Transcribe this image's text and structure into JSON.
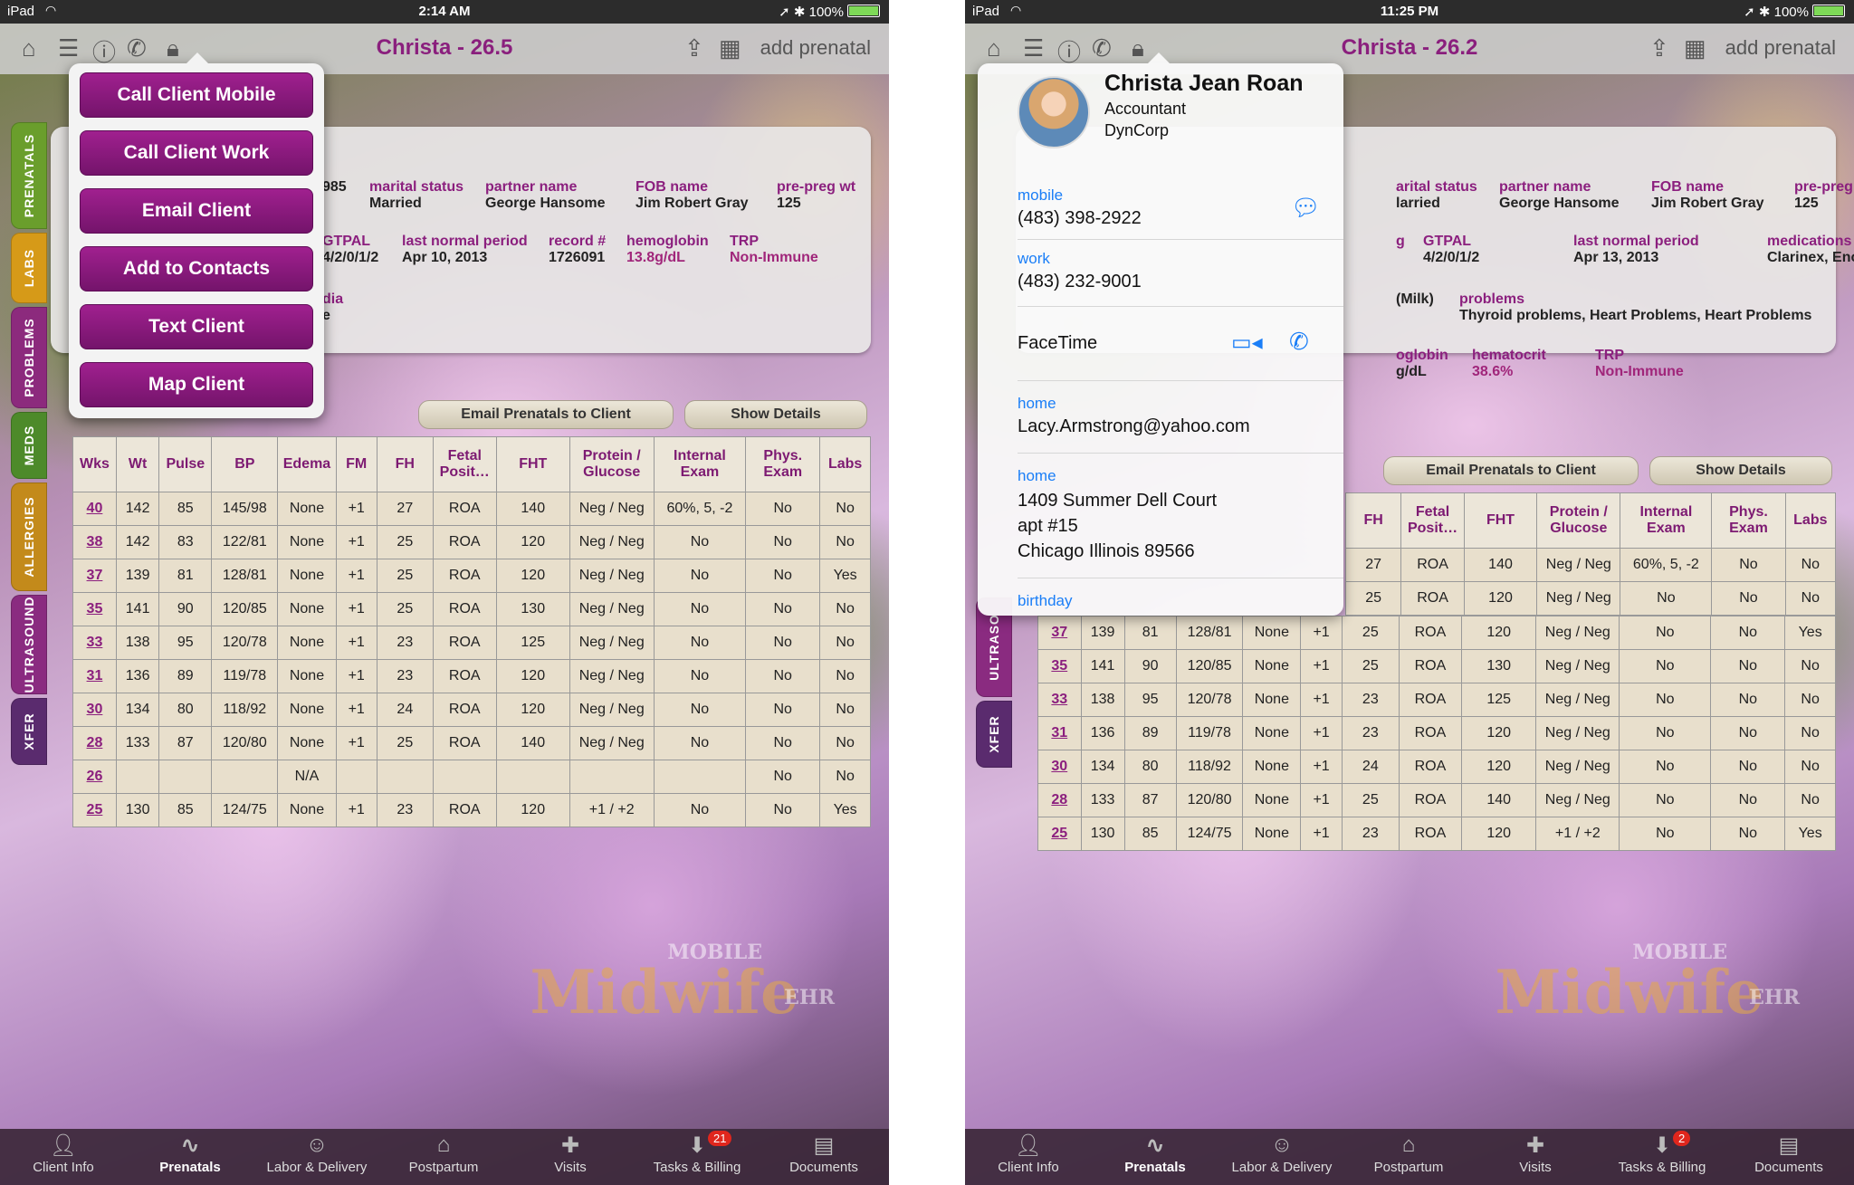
{
  "left": {
    "status": {
      "carrier": "iPad",
      "time": "2:14 AM",
      "battery": "100%"
    },
    "nav": {
      "title": "Christa - 26.5",
      "add_label": "add prenatal"
    },
    "side_tabs": [
      {
        "label": "PRENATALS",
        "color": "#6a9e2c"
      },
      {
        "label": "LABS",
        "color": "#d69a18"
      },
      {
        "label": "PROBLEMS",
        "color": "#8c2a7d"
      },
      {
        "label": "MEDS",
        "color": "#4d8a2a"
      },
      {
        "label": "ALLERGIES",
        "color": "#c38a1b"
      },
      {
        "label": "ULTRASOUND",
        "color": "#8a2b80"
      },
      {
        "label": "XFER",
        "color": "#5a2b6e"
      }
    ],
    "summary": {
      "row1": [
        {
          "label": "",
          "value": "985"
        },
        {
          "label": "marital status",
          "value": "Married"
        },
        {
          "label": "partner name",
          "value": "George Hansome"
        },
        {
          "label": "FOB name",
          "value": "Jim Robert Gray"
        },
        {
          "label": "pre-preg wt",
          "value": "125"
        }
      ],
      "row2": [
        {
          "label": "GTPAL",
          "value": "4/2/0/1/2"
        },
        {
          "label": "last normal period",
          "value": "Apr 10, 2013"
        },
        {
          "label": "record #",
          "value": "1726091"
        },
        {
          "label": "hemoglobin",
          "value": "13.8g/dL"
        },
        {
          "label": "TRP",
          "value": "Non-Immune"
        }
      ],
      "row3": [
        {
          "label": "dia",
          "value": "e"
        }
      ]
    },
    "buttons": {
      "email": "Email Prenatals to Client",
      "details": "Show Details"
    },
    "menu": [
      "Call Client Mobile",
      "Call Client Work",
      "Email Client",
      "Add to Contacts",
      "Text Client",
      "Map Client"
    ],
    "table": {
      "headers": [
        "Wks",
        "Wt",
        "Pulse",
        "BP",
        "Edema",
        "FM",
        "FH",
        "Fetal Posit…",
        "FHT",
        "Protein / Glucose",
        "Internal Exam",
        "Phys. Exam",
        "Labs"
      ],
      "rows": [
        [
          "40",
          "142",
          "85",
          "145/98",
          "None",
          "+1",
          "27",
          "ROA",
          "140",
          "Neg / Neg",
          "60%, 5, -2",
          "No",
          "No"
        ],
        [
          "38",
          "142",
          "83",
          "122/81",
          "None",
          "+1",
          "25",
          "ROA",
          "120",
          "Neg / Neg",
          "No",
          "No",
          "No"
        ],
        [
          "37",
          "139",
          "81",
          "128/81",
          "None",
          "+1",
          "25",
          "ROA",
          "120",
          "Neg / Neg",
          "No",
          "No",
          "Yes"
        ],
        [
          "35",
          "141",
          "90",
          "120/85",
          "None",
          "+1",
          "25",
          "ROA",
          "130",
          "Neg / Neg",
          "No",
          "No",
          "No"
        ],
        [
          "33",
          "138",
          "95",
          "120/78",
          "None",
          "+1",
          "23",
          "ROA",
          "125",
          "Neg / Neg",
          "No",
          "No",
          "No"
        ],
        [
          "31",
          "136",
          "89",
          "119/78",
          "None",
          "+1",
          "23",
          "ROA",
          "120",
          "Neg / Neg",
          "No",
          "No",
          "No"
        ],
        [
          "30",
          "134",
          "80",
          "118/92",
          "None",
          "+1",
          "24",
          "ROA",
          "120",
          "Neg / Neg",
          "No",
          "No",
          "No"
        ],
        [
          "28",
          "133",
          "87",
          "120/80",
          "None",
          "+1",
          "25",
          "ROA",
          "140",
          "Neg / Neg",
          "No",
          "No",
          "No"
        ],
        [
          "26",
          "",
          "",
          "",
          "N/A",
          "",
          "",
          "",
          "",
          "",
          "",
          "No",
          "No"
        ],
        [
          "25",
          "130",
          "85",
          "124/75",
          "None",
          "+1",
          "23",
          "ROA",
          "120",
          "+1 / +2",
          "No",
          "No",
          "Yes"
        ]
      ]
    },
    "tabs": [
      "Client Info",
      "Prenatals",
      "Labor & Delivery",
      "Postpartum",
      "Visits",
      "Tasks & Billing",
      "Documents"
    ],
    "tasks_badge": "21"
  },
  "right": {
    "status": {
      "carrier": "iPad",
      "time": "11:25 PM",
      "battery": "100%"
    },
    "nav": {
      "title": "Christa - 26.2",
      "add_label": "add prenatal"
    },
    "side_tabs": [
      {
        "label": "ULTRASO",
        "color": "#8a2b80"
      },
      {
        "label": "XFER",
        "color": "#5a2b6e"
      }
    ],
    "summary": {
      "row1": [
        {
          "label": "arital status",
          "value": "larried"
        },
        {
          "label": "partner name",
          "value": "George Hansome"
        },
        {
          "label": "FOB name",
          "value": "Jim Robert Gray"
        },
        {
          "label": "pre-preg wt",
          "value": "125"
        }
      ],
      "row2": [
        {
          "label": "g",
          "value": ""
        },
        {
          "label": "GTPAL",
          "value": "4/2/0/1/2"
        },
        {
          "label": "last normal period",
          "value": "Apr 13, 2013"
        },
        {
          "label": "medications",
          "value": "Clarinex, Enoxaparin, Astelin"
        }
      ],
      "row3": [
        {
          "label": "",
          "value": "(Milk)"
        },
        {
          "label": "problems",
          "value": "Thyroid problems, Heart Problems, Heart Problems"
        }
      ],
      "row4": [
        {
          "label": "oglobin",
          "value": "g/dL"
        },
        {
          "label": "hematocrit",
          "value": "38.6%"
        },
        {
          "label": "TRP",
          "value": "Non-Immune"
        }
      ]
    },
    "buttons": {
      "email": "Email Prenatals to Client",
      "details": "Show Details"
    },
    "contact": {
      "name": "Christa Jean Roan",
      "job": "Accountant",
      "company": "DynCorp",
      "mobile_label": "mobile",
      "mobile": "(483) 398-2922",
      "work_label": "work",
      "work": "(483) 232-9001",
      "facetime": "FaceTime",
      "email_label": "home",
      "email": "Lacy.Armstrong@yahoo.com",
      "address_label": "home",
      "address1": "1409 Summer Dell Court",
      "address2": "apt #15",
      "address3": "Chicago Illinois 89566",
      "birthday_label": "birthday"
    },
    "table": {
      "headers": [
        "FH",
        "Fetal Posit…",
        "FHT",
        "Protein / Glucose",
        "Internal Exam",
        "Phys. Exam",
        "Labs"
      ],
      "top_rows": [
        [
          "27",
          "ROA",
          "140",
          "Neg / Neg",
          "60%, 5, -2",
          "No",
          "No"
        ],
        [
          "25",
          "ROA",
          "120",
          "Neg / Neg",
          "No",
          "No",
          "No"
        ]
      ],
      "rows": [
        [
          "37",
          "139",
          "81",
          "128/81",
          "None",
          "+1",
          "25",
          "ROA",
          "120",
          "Neg / Neg",
          "No",
          "No",
          "Yes"
        ],
        [
          "35",
          "141",
          "90",
          "120/85",
          "None",
          "+1",
          "25",
          "ROA",
          "130",
          "Neg / Neg",
          "No",
          "No",
          "No"
        ],
        [
          "33",
          "138",
          "95",
          "120/78",
          "None",
          "+1",
          "23",
          "ROA",
          "125",
          "Neg / Neg",
          "No",
          "No",
          "No"
        ],
        [
          "31",
          "136",
          "89",
          "119/78",
          "None",
          "+1",
          "23",
          "ROA",
          "120",
          "Neg / Neg",
          "No",
          "No",
          "No"
        ],
        [
          "30",
          "134",
          "80",
          "118/92",
          "None",
          "+1",
          "24",
          "ROA",
          "120",
          "Neg / Neg",
          "No",
          "No",
          "No"
        ],
        [
          "28",
          "133",
          "87",
          "120/80",
          "None",
          "+1",
          "25",
          "ROA",
          "140",
          "Neg / Neg",
          "No",
          "No",
          "No"
        ],
        [
          "25",
          "130",
          "85",
          "124/75",
          "None",
          "+1",
          "23",
          "ROA",
          "120",
          "+1 / +2",
          "No",
          "No",
          "Yes"
        ]
      ]
    },
    "tabs": [
      "Client Info",
      "Prenatals",
      "Labor & Delivery",
      "Postpartum",
      "Visits",
      "Tasks & Billing",
      "Documents"
    ],
    "tasks_badge": "2"
  },
  "brand": {
    "mobile": "MOBILE",
    "name": "Midwife",
    "ehr": "EHR"
  }
}
